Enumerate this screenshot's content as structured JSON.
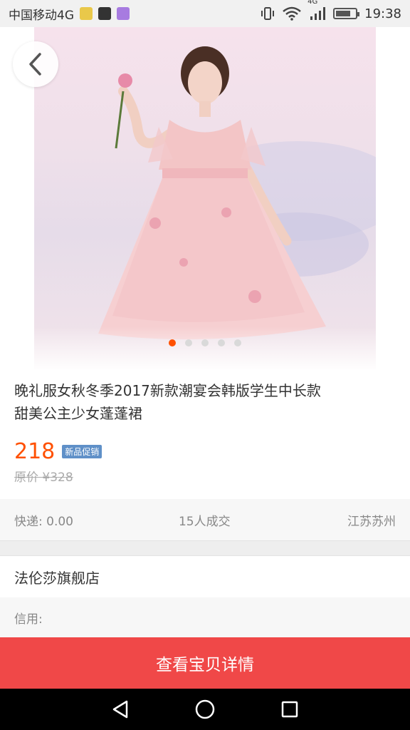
{
  "status_bar": {
    "carrier": "中国移动4G",
    "network_badge": "4G",
    "time": "19:38",
    "battery_level": 0.75,
    "icons": [
      "app-icon-1",
      "app-icon-2",
      "app-icon-3",
      "vibrate-icon",
      "wifi-icon",
      "signal-icon",
      "battery-icon"
    ]
  },
  "gallery": {
    "image_count": 5,
    "active_index": 0,
    "back_icon": "chevron-left-icon"
  },
  "product": {
    "title": "晚礼服女秋冬季2017新款潮宴会韩版学生中长款甜美公主少女蓬蓬裙",
    "price": "218",
    "promo_badge": "新品促销",
    "original_price": "原价 ¥328"
  },
  "meta": {
    "shipping": "快递: 0.00",
    "sales": "15人成交",
    "location": "江苏苏州"
  },
  "shop": {
    "name": "法伦莎旗舰店",
    "credit_label": "信用:"
  },
  "cta": {
    "label": "查看宝贝详情"
  },
  "colors": {
    "accent": "#ff5000",
    "cta_bg": "#f04848",
    "promo_bg": "#5f90c8"
  },
  "navbar": {
    "icons": [
      "back-triangle-icon",
      "home-circle-icon",
      "recents-square-icon"
    ]
  }
}
